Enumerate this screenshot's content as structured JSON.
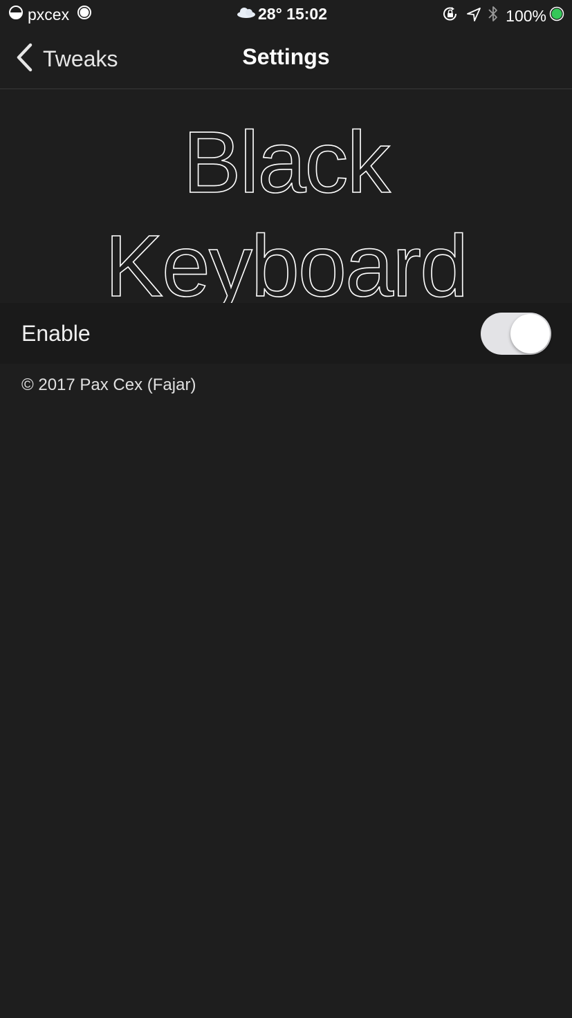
{
  "status_bar": {
    "carrier": "pxcex",
    "weather_icon": "cloud-icon",
    "time": "28° 15:02",
    "battery_percent": "100%",
    "battery_color": "#35c759"
  },
  "nav": {
    "back_label": "Tweaks",
    "title": "Settings"
  },
  "header": {
    "banner_text": "Black Keyboard"
  },
  "settings": {
    "enable_label": "Enable",
    "enable_value": false
  },
  "footer": {
    "copyright": "© 2017 Pax Cex (Fajar)"
  }
}
